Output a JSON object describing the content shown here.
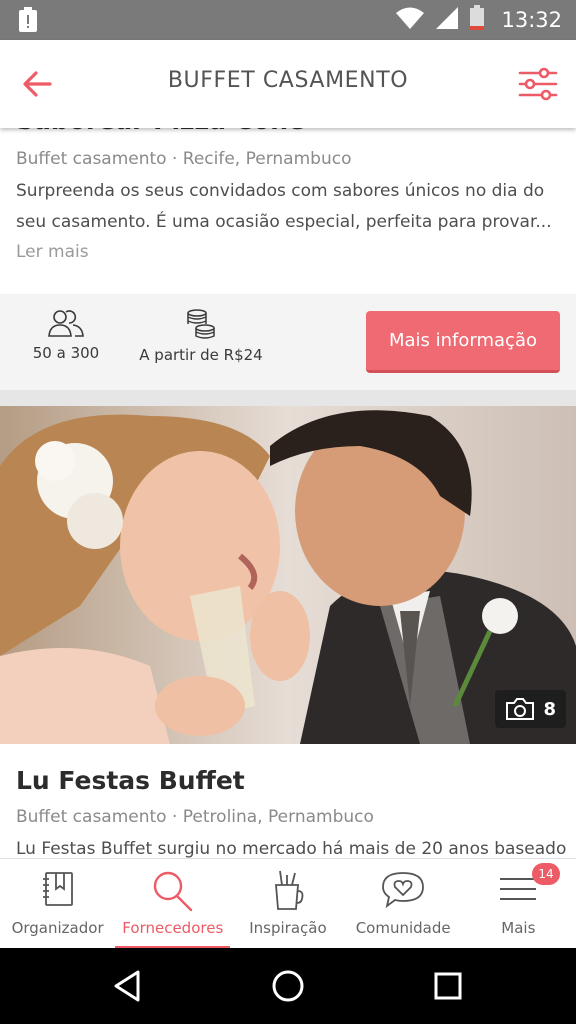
{
  "status_bar": {
    "time": "13:32",
    "icons": [
      "notification-icon",
      "wifi-icon",
      "signal-icon",
      "battery-icon"
    ]
  },
  "app_bar": {
    "title": "BUFFET CASAMENTO",
    "back_icon": "arrow-left-icon",
    "filter_icon": "sliders-icon",
    "accent_color": "#ec5b66"
  },
  "listings": [
    {
      "name": "Saborear Pizza Cone",
      "category": "Buffet casamento · Recife, Pernambuco",
      "description": "Surpreenda os seus convidados com sabores únicos no dia do seu casamento. É uma ocasião especial, perfeita para provar...",
      "read_more": "Ler mais",
      "guests": "50 a 300",
      "price": "A partir de R$24",
      "cta": "Mais informação"
    },
    {
      "name": "Lu Festas Buffet",
      "category": "Buffet casamento · Petrolina, Pernambuco",
      "description": "Lu Festas Buffet surgiu no mercado há mais de 20 anos baseado",
      "photo_count": "8"
    }
  ],
  "bottom_nav": {
    "items": [
      {
        "label": "Organizador",
        "icon": "notebook-icon"
      },
      {
        "label": "Fornecedores",
        "icon": "search-icon"
      },
      {
        "label": "Inspiração",
        "icon": "inspiration-cup-icon"
      },
      {
        "label": "Comunidade",
        "icon": "chat-heart-icon"
      },
      {
        "label": "Mais",
        "icon": "menu-icon"
      }
    ],
    "active": "Fornecedores",
    "badge": "14"
  }
}
